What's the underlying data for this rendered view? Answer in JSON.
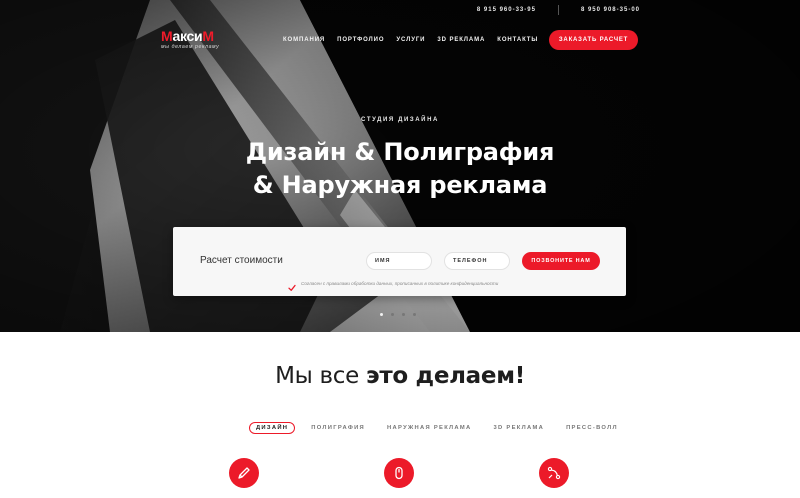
{
  "header": {
    "phones": [
      "8 915 960-33-95",
      "8 950 908-35-00"
    ],
    "logo": {
      "text_red_1": "М",
      "text_white": "акси",
      "text_red_2": "М",
      "tagline": "мы делаем рекламу"
    },
    "nav": [
      "КОМПАНИЯ",
      "ПОРТФОЛИО",
      "УСЛУГИ",
      "3D РЕКЛАМА",
      "КОНТАКТЫ"
    ],
    "order_button": "ЗАКАЗАТЬ РАСЧЕТ"
  },
  "hero": {
    "kicker": "СТУДИЯ ДИЗАЙНА",
    "headline_line1": "Дизайн & Полиграфия",
    "headline_line2": "& Наружная реклама",
    "slider": {
      "total": 4,
      "active": 1
    }
  },
  "calc_form": {
    "title": "Расчет стоимости",
    "name_placeholder": "ИМЯ",
    "phone_placeholder": "ТЕЛЕФОН",
    "submit": "ПОЗВОНИТЕ НАМ",
    "consent": "Согласен с правилами обработки данных, прописанных в политике конфиденциальности",
    "consent_checked": true
  },
  "services": {
    "title_regular": "Мы все ",
    "title_bold": "это делаем!",
    "tabs": [
      "ДИЗАЙН",
      "ПОЛИГРАФИЯ",
      "НАРУЖНАЯ РЕКЛАМА",
      "3D РЕКЛАМА",
      "ПРЕСС-ВОЛЛ"
    ],
    "active_tab": 0,
    "icons": [
      "pencil-icon",
      "mouse-icon",
      "vector-path-icon"
    ]
  },
  "colors": {
    "accent": "#ec1a29",
    "hero_bg": "#070707",
    "text_dark": "#1e1e1e"
  }
}
